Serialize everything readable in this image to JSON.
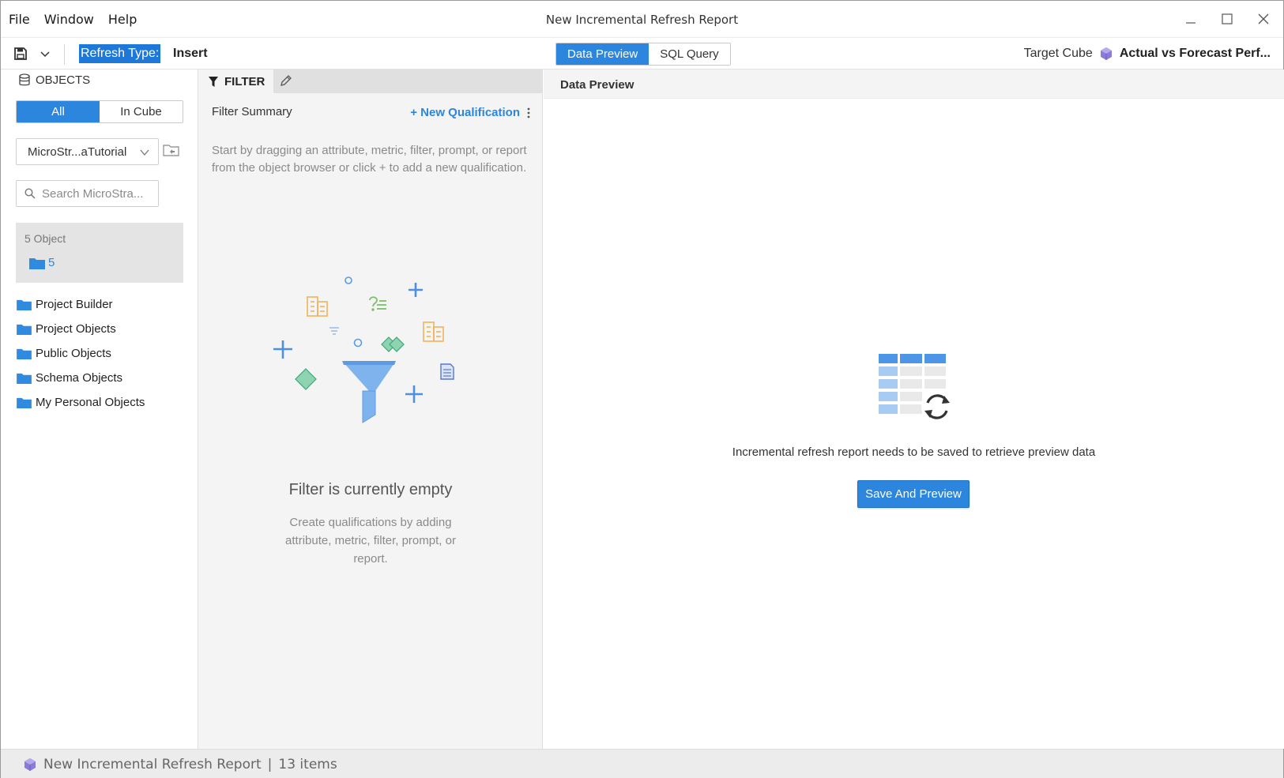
{
  "window": {
    "title": "New Incremental Refresh Report",
    "menu": [
      "File",
      "Window",
      "Help"
    ]
  },
  "toolbar": {
    "refresh_type_label": "Refresh Type:",
    "refresh_type_value": "Insert",
    "tabs": [
      "Data Preview",
      "SQL Query"
    ],
    "active_tab": "Data Preview",
    "target_cube_label": "Target Cube",
    "target_cube_name": "Actual vs Forecast Perf..."
  },
  "objects": {
    "header": "OBJECTS",
    "toggle": [
      "All",
      "In Cube"
    ],
    "active_toggle": "All",
    "project": "MicroStr...aTutorial",
    "search_placeholder": "Search MicroStra...",
    "recent_count": "5 Object",
    "recent_folder": "5",
    "tree": [
      "Project Builder",
      "Project Objects",
      "Public Objects",
      "Schema Objects",
      "My Personal Objects"
    ]
  },
  "filter": {
    "tab": "FILTER",
    "summary": "Filter Summary",
    "new_qualification": "+ New Qualification",
    "hint": "Start by dragging an attribute, metric, filter, prompt, or report from the object browser or click + to add a new qualification.",
    "empty_title": "Filter is currently empty",
    "empty_sub": "Create qualifications by adding attribute, metric, filter, prompt, or report."
  },
  "preview": {
    "title": "Data Preview",
    "message": "Incremental refresh report needs to be saved to retrieve preview data",
    "save_button": "Save And Preview"
  },
  "statusbar": {
    "name": "New Incremental Refresh Report",
    "separator": "|",
    "items": "13 items"
  },
  "colors": {
    "accent": "#2d86de",
    "folder": "#2f8ae0",
    "cube": "#8b7bd8"
  }
}
